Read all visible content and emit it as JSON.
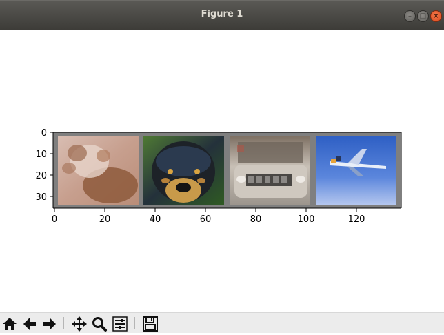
{
  "window": {
    "title": "Figure 1",
    "controls": [
      "minimize-icon",
      "maximize-icon",
      "close-icon"
    ]
  },
  "figure": {
    "images": [
      {
        "subject": "dog (light brown, lying)",
        "colors": [
          "#c9a699",
          "#8e5a3c",
          "#e7d4cb"
        ]
      },
      {
        "subject": "dog (black puppy)",
        "colors": [
          "#1d2228",
          "#3e6b2a",
          "#c89a4a"
        ]
      },
      {
        "subject": "car (silver)",
        "colors": [
          "#b7afa6",
          "#8a8580",
          "#d9d3cb"
        ]
      },
      {
        "subject": "airplane",
        "colors": [
          "#3f6fd0",
          "#8fb0ea",
          "#cfd7ee"
        ]
      }
    ],
    "grid_border_color": "#7f7f7f",
    "x_ticks": [
      "0",
      "20",
      "40",
      "60",
      "80",
      "100",
      "120"
    ],
    "y_ticks": [
      "0",
      "10",
      "20",
      "30"
    ],
    "x_range": [
      0,
      138
    ],
    "y_range": [
      0,
      36
    ]
  },
  "toolbar": {
    "buttons": [
      "home-icon",
      "back-icon",
      "forward-icon",
      "pan-icon",
      "zoom-icon",
      "configure-subplots-icon",
      "save-icon"
    ]
  }
}
